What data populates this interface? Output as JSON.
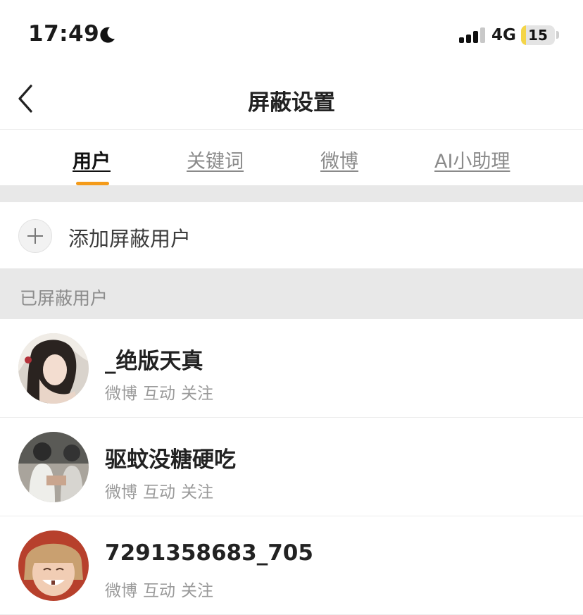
{
  "status_bar": {
    "time": "17:49",
    "network": "4G",
    "battery": "15",
    "battery_level_percent": 15,
    "battery_color": "#f4d548"
  },
  "nav": {
    "title": "屏蔽设置",
    "back_icon": "chevron-left-icon"
  },
  "tabs": [
    {
      "label": "用户",
      "active": true
    },
    {
      "label": "关键词",
      "active": false
    },
    {
      "label": "微博",
      "active": false
    },
    {
      "label": "AI小助理",
      "active": false
    }
  ],
  "accent_color": "#f49b1a",
  "add_row": {
    "label": "添加屏蔽用户",
    "icon": "plus-icon"
  },
  "section": {
    "title": "已屏蔽用户"
  },
  "users": [
    {
      "name": "_绝版天真",
      "tags": [
        "微博",
        "互动",
        "关注"
      ]
    },
    {
      "name": "驱蚊没糖硬吃",
      "tags": [
        "微博",
        "互动",
        "关注"
      ]
    },
    {
      "name": "7291358683_705",
      "tags": [
        "微博",
        "互动",
        "关注"
      ]
    }
  ]
}
